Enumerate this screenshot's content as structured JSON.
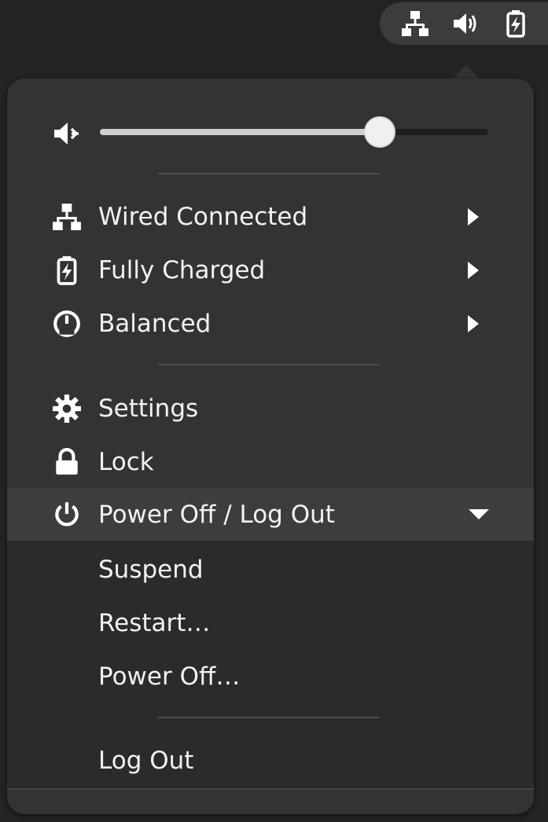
{
  "top_bar": {
    "indicators": [
      {
        "icon": "network-wired-icon"
      },
      {
        "icon": "speaker-volume-icon"
      },
      {
        "icon": "battery-charging-icon"
      }
    ]
  },
  "volume": {
    "icon": "speaker-muted-icon",
    "level": 0.72
  },
  "status_items": [
    {
      "label": "Wired Connected",
      "icon": "network-wired-icon",
      "has_submenu": true
    },
    {
      "label": "Fully Charged",
      "icon": "battery-charging-icon",
      "has_submenu": true
    },
    {
      "label": "Balanced",
      "icon": "power-profile-icon",
      "has_submenu": true
    }
  ],
  "actions": [
    {
      "label": "Settings",
      "icon": "gear-icon"
    },
    {
      "label": "Lock",
      "icon": "lock-icon"
    }
  ],
  "power_menu": {
    "label": "Power Off / Log Out",
    "icon": "power-icon",
    "expanded": true,
    "items": [
      {
        "label": "Suspend"
      },
      {
        "label": "Restart…"
      },
      {
        "label": "Power Off…"
      }
    ],
    "logout_label": "Log Out"
  },
  "colors": {
    "menu_bg": "#333333",
    "submenu_bg": "#2b2b2b",
    "highlight_bg": "#3d3d3d",
    "text": "#f2f2f2"
  }
}
